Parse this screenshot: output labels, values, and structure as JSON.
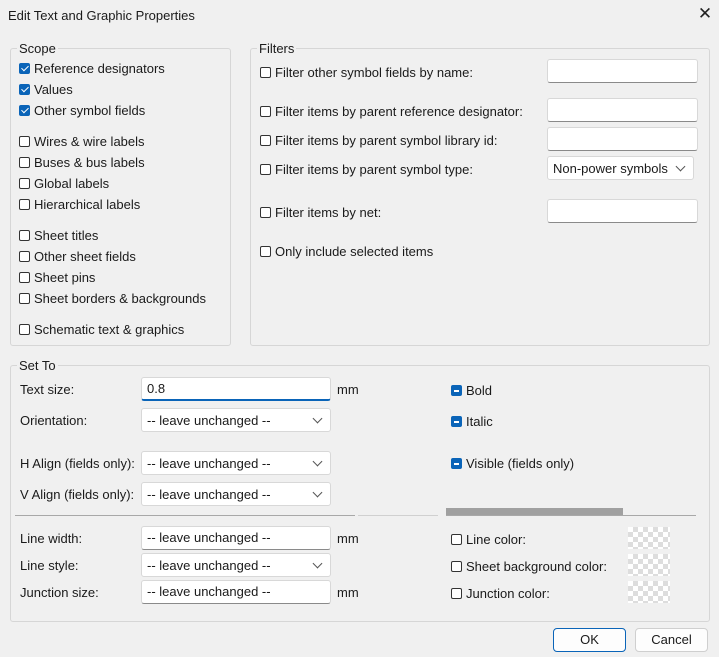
{
  "window": {
    "title": "Edit Text and Graphic Properties",
    "close_glyph": "✕"
  },
  "scope": {
    "label": "Scope",
    "items": [
      {
        "label": "Reference designators",
        "checked": true
      },
      {
        "label": "Values",
        "checked": true
      },
      {
        "label": "Other symbol fields",
        "checked": true
      },
      {
        "label": "Wires & wire labels",
        "checked": false
      },
      {
        "label": "Buses & bus labels",
        "checked": false
      },
      {
        "label": "Global labels",
        "checked": false
      },
      {
        "label": "Hierarchical labels",
        "checked": false
      },
      {
        "label": "Sheet titles",
        "checked": false
      },
      {
        "label": "Other sheet fields",
        "checked": false
      },
      {
        "label": "Sheet pins",
        "checked": false
      },
      {
        "label": "Sheet borders & backgrounds",
        "checked": false
      },
      {
        "label": "Schematic text & graphics",
        "checked": false
      }
    ]
  },
  "filters": {
    "label": "Filters",
    "items": [
      {
        "label": "Filter other symbol fields by name:",
        "value": ""
      },
      {
        "label": "Filter items by parent reference designator:",
        "value": ""
      },
      {
        "label": "Filter items by parent symbol library id:",
        "value": ""
      },
      {
        "label": "Filter items by parent symbol type:",
        "value": "Non-power symbols"
      },
      {
        "label": "Filter items by net:",
        "value": ""
      },
      {
        "label": "Only include selected items"
      }
    ]
  },
  "setto": {
    "label": "Set To",
    "text_size": {
      "label": "Text size:",
      "value": "0.8",
      "unit": "mm"
    },
    "orientation": {
      "label": "Orientation:",
      "value": "-- leave unchanged --"
    },
    "halign": {
      "label": "H Align (fields only):",
      "value": "-- leave unchanged --"
    },
    "valign": {
      "label": "V Align (fields only):",
      "value": "-- leave unchanged --"
    },
    "bold": {
      "label": "Bold",
      "state": "mixed"
    },
    "italic": {
      "label": "Italic",
      "state": "mixed"
    },
    "visible": {
      "label": "Visible (fields only)",
      "state": "mixed"
    },
    "line_width": {
      "label": "Line width:",
      "value": "-- leave unchanged --",
      "unit": "mm"
    },
    "line_style": {
      "label": "Line style:",
      "value": "-- leave unchanged --"
    },
    "junction_size": {
      "label": "Junction size:",
      "value": "-- leave unchanged --",
      "unit": "mm"
    },
    "line_color": {
      "label": "Line color:"
    },
    "sheet_bg_color": {
      "label": "Sheet background color:"
    },
    "junction_color": {
      "label": "Junction color:"
    }
  },
  "buttons": {
    "ok": "OK",
    "cancel": "Cancel"
  }
}
